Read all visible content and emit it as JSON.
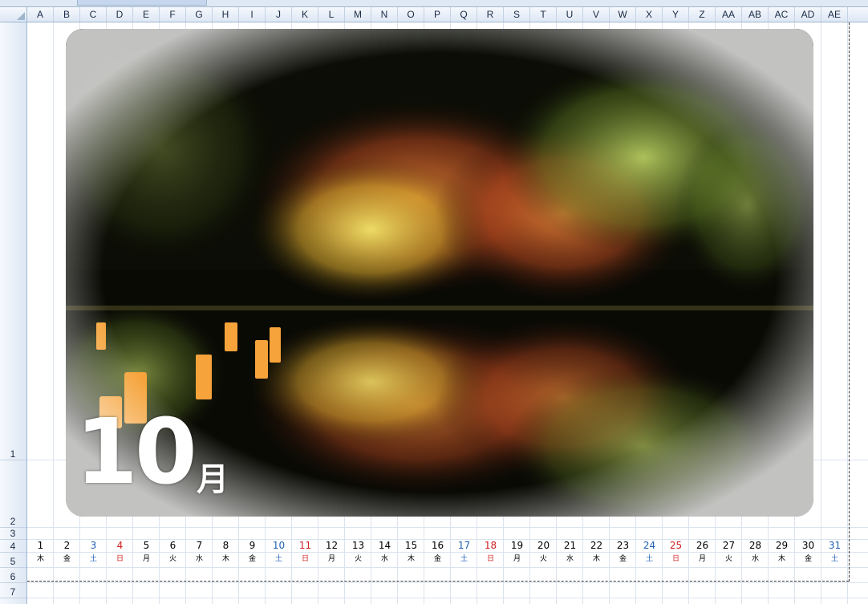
{
  "columns": [
    "A",
    "B",
    "C",
    "D",
    "E",
    "F",
    "G",
    "H",
    "I",
    "J",
    "K",
    "L",
    "M",
    "N",
    "O",
    "P",
    "Q",
    "R",
    "S",
    "T",
    "U",
    "V",
    "W",
    "X",
    "Y",
    "Z",
    "AA",
    "AB",
    "AC",
    "AD",
    "AE"
  ],
  "rows": [
    "1",
    "2",
    "3",
    "4",
    "5",
    "6",
    "7"
  ],
  "calendar": {
    "month_number": "10",
    "month_unit": "月",
    "days": [
      {
        "d": "1",
        "wd": "木",
        "color": "#000000"
      },
      {
        "d": "2",
        "wd": "金",
        "color": "#000000"
      },
      {
        "d": "3",
        "wd": "土",
        "color": "#1f5fb5"
      },
      {
        "d": "4",
        "wd": "日",
        "color": "#d02020"
      },
      {
        "d": "5",
        "wd": "月",
        "color": "#000000"
      },
      {
        "d": "6",
        "wd": "火",
        "color": "#000000"
      },
      {
        "d": "7",
        "wd": "水",
        "color": "#000000"
      },
      {
        "d": "8",
        "wd": "木",
        "color": "#000000"
      },
      {
        "d": "9",
        "wd": "金",
        "color": "#000000"
      },
      {
        "d": "10",
        "wd": "土",
        "color": "#1f5fb5"
      },
      {
        "d": "11",
        "wd": "日",
        "color": "#d02020"
      },
      {
        "d": "12",
        "wd": "月",
        "color": "#000000"
      },
      {
        "d": "13",
        "wd": "火",
        "color": "#000000"
      },
      {
        "d": "14",
        "wd": "水",
        "color": "#000000"
      },
      {
        "d": "15",
        "wd": "木",
        "color": "#000000"
      },
      {
        "d": "16",
        "wd": "金",
        "color": "#000000"
      },
      {
        "d": "17",
        "wd": "土",
        "color": "#1f5fb5"
      },
      {
        "d": "18",
        "wd": "日",
        "color": "#d02020"
      },
      {
        "d": "19",
        "wd": "月",
        "color": "#000000"
      },
      {
        "d": "20",
        "wd": "火",
        "color": "#000000"
      },
      {
        "d": "21",
        "wd": "水",
        "color": "#000000"
      },
      {
        "d": "22",
        "wd": "木",
        "color": "#000000"
      },
      {
        "d": "23",
        "wd": "金",
        "color": "#000000"
      },
      {
        "d": "24",
        "wd": "土",
        "color": "#1f5fb5"
      },
      {
        "d": "25",
        "wd": "日",
        "color": "#d02020"
      },
      {
        "d": "26",
        "wd": "月",
        "color": "#000000"
      },
      {
        "d": "27",
        "wd": "火",
        "color": "#000000"
      },
      {
        "d": "28",
        "wd": "水",
        "color": "#000000"
      },
      {
        "d": "29",
        "wd": "木",
        "color": "#000000"
      },
      {
        "d": "30",
        "wd": "金",
        "color": "#000000"
      },
      {
        "d": "31",
        "wd": "土",
        "color": "#1f5fb5"
      }
    ]
  },
  "colors": {
    "header_bg": "#dde7f4",
    "gridline": "#dbe3ee",
    "saturday": "#1f5fb5",
    "sunday": "#d02020"
  }
}
